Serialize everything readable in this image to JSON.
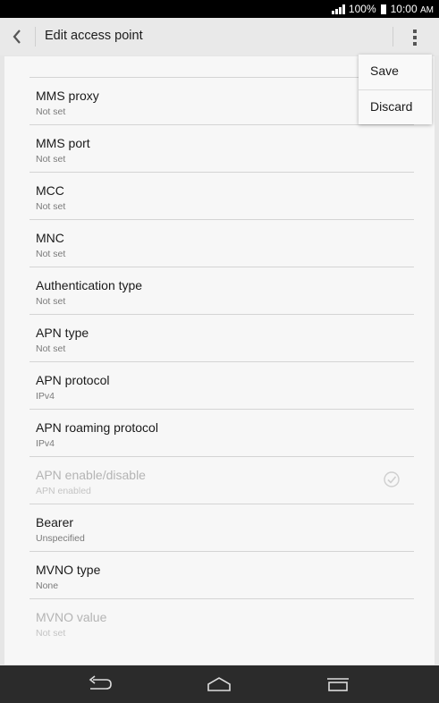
{
  "status_bar": {
    "battery": "100%",
    "time": "10:00",
    "ampm": "AM"
  },
  "action_bar": {
    "title": "Edit access point",
    "back_icon": "chevron-left-icon",
    "overflow_icon": "more-vert-icon"
  },
  "menu": {
    "items": [
      {
        "label": "Save"
      },
      {
        "label": "Discard"
      }
    ]
  },
  "settings": [
    {
      "label": "MMS proxy",
      "value": "Not set"
    },
    {
      "label": "MMS port",
      "value": "Not set"
    },
    {
      "label": "MCC",
      "value": "Not set"
    },
    {
      "label": "MNC",
      "value": "Not set"
    },
    {
      "label": "Authentication type",
      "value": "Not set"
    },
    {
      "label": "APN type",
      "value": "Not set"
    },
    {
      "label": "APN protocol",
      "value": "IPv4"
    },
    {
      "label": "APN roaming protocol",
      "value": "IPv4"
    },
    {
      "label": "APN enable/disable",
      "value": "APN enabled",
      "disabled": true,
      "checked": true
    },
    {
      "label": "Bearer",
      "value": "Unspecified"
    },
    {
      "label": "MVNO type",
      "value": "None"
    },
    {
      "label": "MVNO value",
      "value": "Not set",
      "disabled": true
    }
  ],
  "nav_bar": {
    "back_icon": "back-arrow-icon",
    "home_icon": "home-icon",
    "recents_icon": "recent-apps-icon"
  },
  "colors": {
    "status_bar": "#000000",
    "action_bar": "#e9e9e9",
    "card": "#f7f7f7",
    "nav_bar": "#2b2b2b",
    "disabled_text": "#b4b4b4"
  }
}
